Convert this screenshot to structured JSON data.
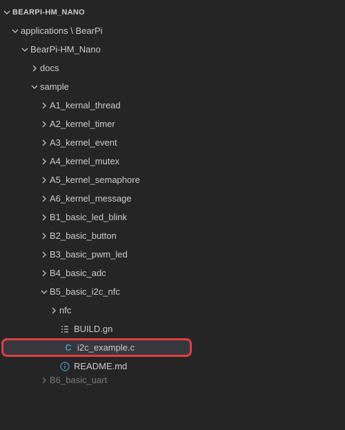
{
  "root": {
    "label": "BEARPI-HM_NANO",
    "expanded": true
  },
  "tree": {
    "applications": {
      "label": "applications \\ BearPi",
      "expanded": true,
      "children": {
        "project": {
          "label": "BearPi-HM_Nano",
          "expanded": true,
          "children": {
            "docs": {
              "label": "docs",
              "expanded": false
            },
            "sample": {
              "label": "sample",
              "expanded": true,
              "children": {
                "a1": {
                  "label": "A1_kernal_thread",
                  "expanded": false
                },
                "a2": {
                  "label": "A2_kernel_timer",
                  "expanded": false
                },
                "a3": {
                  "label": "A3_kernel_event",
                  "expanded": false
                },
                "a4": {
                  "label": "A4_kernel_mutex",
                  "expanded": false
                },
                "a5": {
                  "label": "A5_kernel_semaphore",
                  "expanded": false
                },
                "a6": {
                  "label": "A6_kernel_message",
                  "expanded": false
                },
                "b1": {
                  "label": "B1_basic_led_blink",
                  "expanded": false
                },
                "b2": {
                  "label": "B2_basic_button",
                  "expanded": false
                },
                "b3": {
                  "label": "B3_basic_pwm_led",
                  "expanded": false
                },
                "b4": {
                  "label": "B4_basic_adc",
                  "expanded": false
                },
                "b5": {
                  "label": "B5_basic_i2c_nfc",
                  "expanded": true,
                  "children": {
                    "nfc": {
                      "label": "nfc",
                      "expanded": false
                    },
                    "build": {
                      "label": "BUILD.gn",
                      "type": "file-gn"
                    },
                    "i2c": {
                      "label": "i2c_example.c",
                      "type": "file-c",
                      "selected": true,
                      "highlight": true
                    },
                    "readme": {
                      "label": "README.md",
                      "type": "file-md"
                    }
                  }
                },
                "b6": {
                  "label": "B6_basic_uart",
                  "expanded": false,
                  "cutoff": true
                }
              }
            }
          }
        }
      }
    }
  },
  "icons": {
    "c_letter": "C",
    "info": "i"
  },
  "colors": {
    "c_file": "#519aba",
    "info": "#519aba",
    "build": "#cccccc",
    "chevron": "#c5c5c5"
  }
}
